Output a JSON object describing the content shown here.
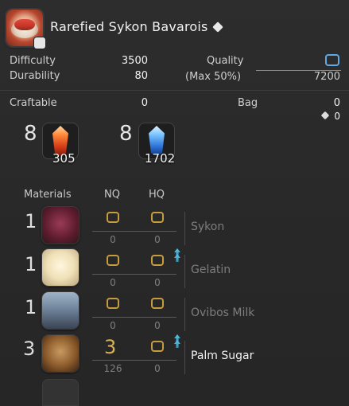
{
  "header": {
    "item_name": "Rarefied Sykon Bavarois"
  },
  "stats": {
    "difficulty_label": "Difficulty",
    "difficulty_value": "3500",
    "durability_label": "Durability",
    "durability_value": "80",
    "quality_label": "Quality",
    "quality_max_label": "(Max 50%)",
    "quality_value": "7200",
    "craftable_label": "Craftable",
    "craftable_value": "0",
    "bag_label": "Bag",
    "bag_value": "0",
    "bag_hq_value": "0"
  },
  "crystals": [
    {
      "required": "8",
      "owned": "305",
      "type": "fire"
    },
    {
      "required": "8",
      "owned": "1702",
      "type": "ice"
    }
  ],
  "materials_header": {
    "materials": "Materials",
    "nq": "NQ",
    "hq": "HQ"
  },
  "materials": [
    {
      "qty": "1",
      "nq": "0",
      "hq": "0",
      "nq_owned": "0",
      "hq_owned": "0",
      "name": "Sykon",
      "hq_up": false,
      "active": false
    },
    {
      "qty": "1",
      "nq": "0",
      "hq": "0",
      "nq_owned": "0",
      "hq_owned": "0",
      "name": "Gelatin",
      "hq_up": true,
      "active": false
    },
    {
      "qty": "1",
      "nq": "0",
      "hq": "0",
      "nq_owned": "0",
      "hq_owned": "0",
      "name": "Ovibos Milk",
      "hq_up": false,
      "active": false
    },
    {
      "qty": "3",
      "nq": "3",
      "hq": "0",
      "nq_owned": "126",
      "hq_owned": "0",
      "name": "Palm Sugar",
      "hq_up": true,
      "active": true
    }
  ],
  "colors": {
    "accent_gold": "#c79c3e",
    "accent_blue": "#5ea9e6",
    "hq_cyan": "#61c6e8"
  }
}
